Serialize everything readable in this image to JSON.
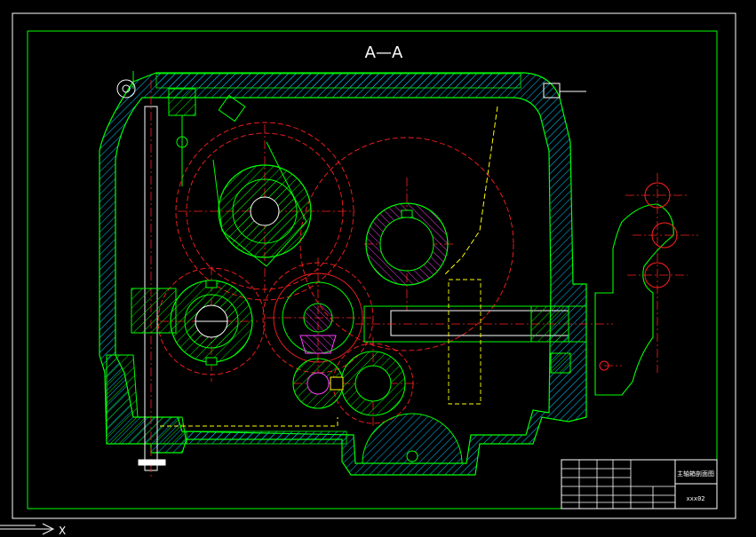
{
  "drawing": {
    "section_title": "A—A",
    "title_block": {
      "drawing_name": "主轴箱剖面图",
      "drawing_code": "xxx02"
    },
    "axis_label": "X"
  },
  "colors": {
    "background": "#000000",
    "frame": "#00ff00",
    "hatch": "#00c8ff",
    "body": "#00ff00",
    "center_line": "#ff2020",
    "hidden_line": "#ffff00",
    "shaft": "#ffffff",
    "accent": "#ff00ff"
  }
}
